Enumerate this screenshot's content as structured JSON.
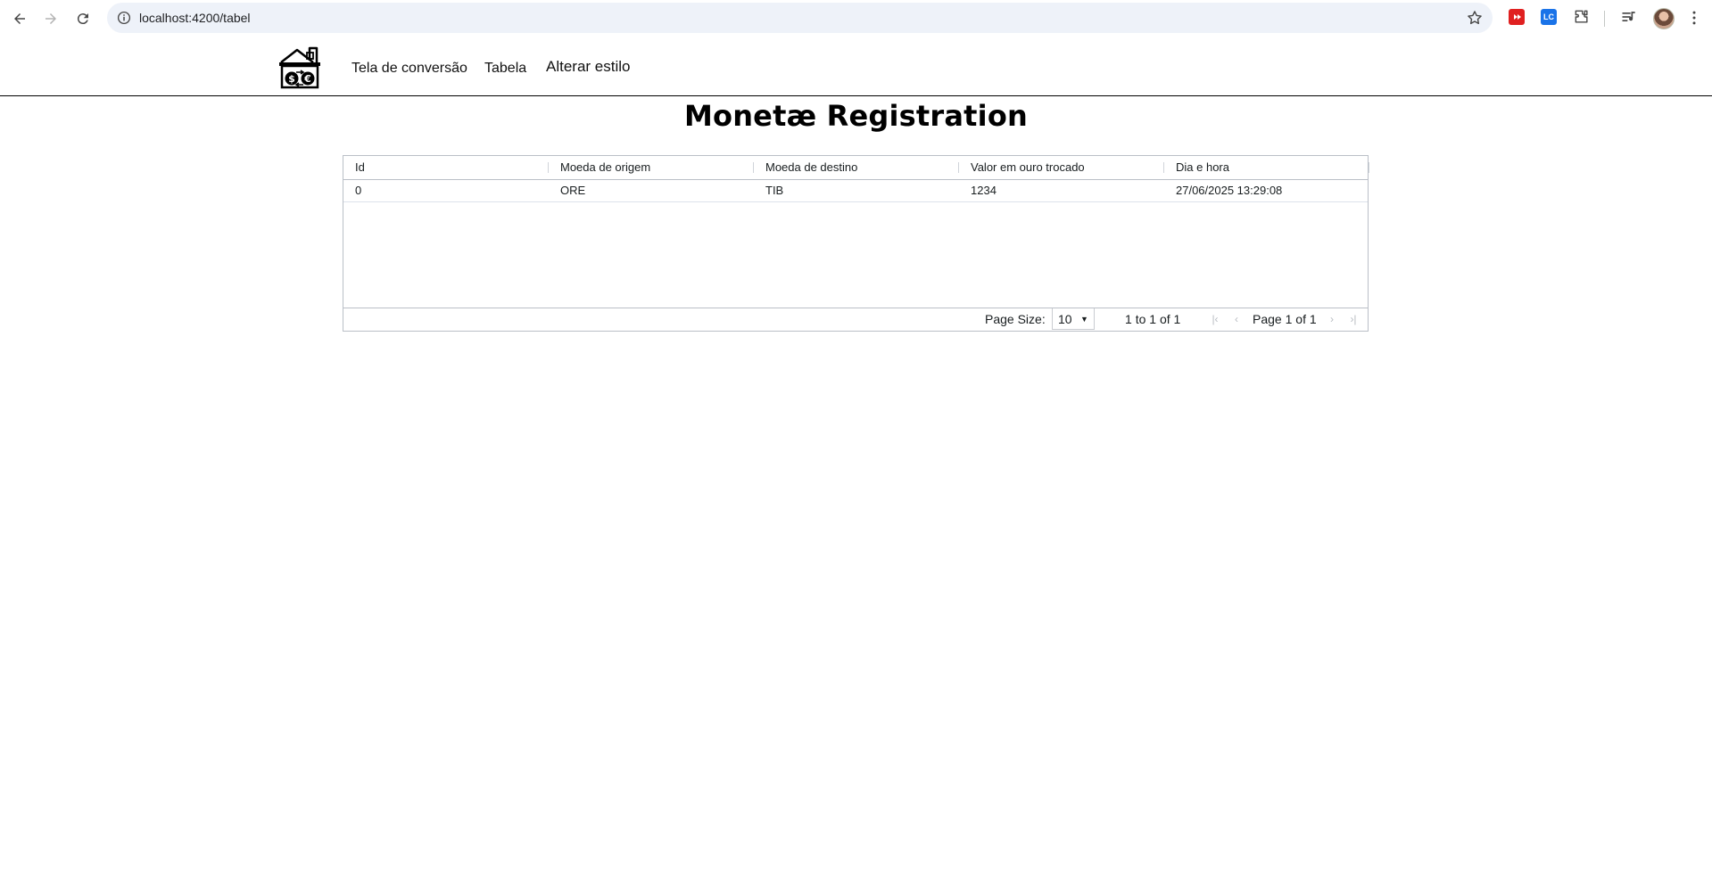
{
  "browser": {
    "url": "localhost:4200/tabel",
    "icons": [
      "back-icon",
      "forward-icon",
      "reload-icon",
      "site-info-icon",
      "bookmark-star-icon",
      "extensions-icon",
      "media-icon",
      "profile-avatar",
      "more-menu-icon"
    ],
    "extensions": [
      {
        "name": "youtube-extension",
        "label": "",
        "color": "#e02020"
      },
      {
        "name": "leetcode-extension",
        "label": "LC",
        "color": "#1a73e8"
      }
    ]
  },
  "navbar": {
    "logo": "exchange-house-logo",
    "links": [
      "Tela de conversão",
      "Tabela",
      "Alterar estilo"
    ]
  },
  "page": {
    "title": "Monetæ Registration"
  },
  "table": {
    "columns": [
      "Id",
      "Moeda de origem",
      "Moeda de destino",
      "Valor em ouro trocado",
      "Dia e hora"
    ],
    "rows": [
      [
        "0",
        "ORE",
        "TIB",
        "1234",
        "27/06/2025 13:29:08"
      ]
    ]
  },
  "pagination": {
    "page_size_label": "Page Size:",
    "page_size": "10",
    "summary_from": "1",
    "summary_to_word": "to",
    "summary_to": "1",
    "summary_of_word": "of",
    "summary_total": "1",
    "page_word": "Page",
    "page_current": "1",
    "page_of_word": "of",
    "page_total": "1"
  },
  "colors": {
    "omnibox": "#eef2f9",
    "grid_border": "#babfc7",
    "disabled_icon": "#b8bcc2"
  }
}
